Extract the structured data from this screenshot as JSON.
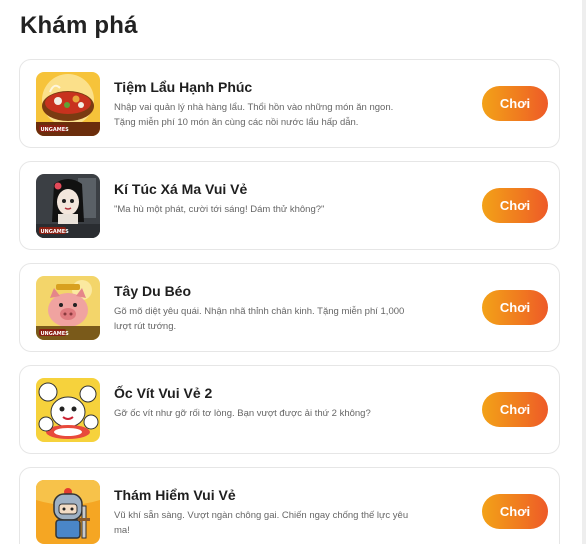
{
  "section": {
    "title": "Khám phá"
  },
  "games": [
    {
      "name": "Tiệm Lẩu Hạnh Phúc",
      "description": "Nhập vai quản lý nhà hàng lẩu. Thổi hồn vào những món ăn ngon. Tặng miễn phí 10 món ăn cùng các nồi nước lẩu hấp dẫn.",
      "play_label": "Chơi",
      "thumb_icon": "hotpot-game-icon",
      "thumb_badge": "UNGAMES"
    },
    {
      "name": "Kí Túc Xá Ma Vui Vẻ",
      "description": "\"Ma hù một phát, cười tới sáng! Dám thử không?\"",
      "play_label": "Chơi",
      "thumb_icon": "ghost-girl-game-icon",
      "thumb_badge": "UNGAMES"
    },
    {
      "name": "Tây Du Béo",
      "description": "Gõ mõ diệt yêu quái. Nhận nhã thỉnh chân kinh. Tặng miễn phí 1,000 lượt rút tướng.",
      "play_label": "Chơi",
      "thumb_icon": "pig-monk-game-icon",
      "thumb_badge": "UNGAMES"
    },
    {
      "name": "Ốc Vít Vui Vẻ 2",
      "description": "Gỡ ốc vít như gỡ rối tơ lòng. Bạn vượt được ải thứ 2 không?",
      "play_label": "Chơi",
      "thumb_icon": "cartoon-characters-game-icon",
      "thumb_badge": ""
    },
    {
      "name": "Thám Hiểm Vui Vẻ",
      "description": "Vũ khí sẵn sàng. Vượt ngàn chông gai. Chiến ngay chống thế lực yêu ma!",
      "play_label": "Chơi",
      "thumb_icon": "knight-game-icon",
      "thumb_badge": ""
    }
  ]
}
